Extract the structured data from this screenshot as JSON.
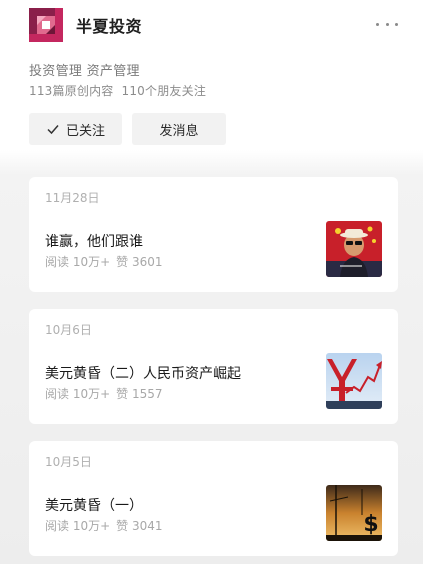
{
  "profile": {
    "name": "半夏投资",
    "tags": "投资管理 资产管理",
    "original_count": "113篇原创内容",
    "friends_following": "110个朋友关注",
    "follow_label": "已关注",
    "message_label": "发消息",
    "colors": {
      "brand": "#c4275f",
      "brand_light": "#e06a8e",
      "brand_dark": "#8a1f4a"
    }
  },
  "articles": [
    {
      "date": "11月28日",
      "title": "谁赢，他们跟谁",
      "reads": "阅读 10万+",
      "likes": "赞 3601",
      "thumb_icon": "portrait-photo"
    },
    {
      "date": "10月6日",
      "title": "美元黄昏（二）人民币资产崛起",
      "reads": "阅读 10万+",
      "likes": "赞 1557",
      "thumb_icon": "yuan-chart-photo"
    },
    {
      "date": "10月5日",
      "title": "美元黄昏（一）",
      "reads": "阅读 10万+",
      "likes": "赞 3041",
      "thumb_icon": "dollar-sunset-photo"
    }
  ]
}
